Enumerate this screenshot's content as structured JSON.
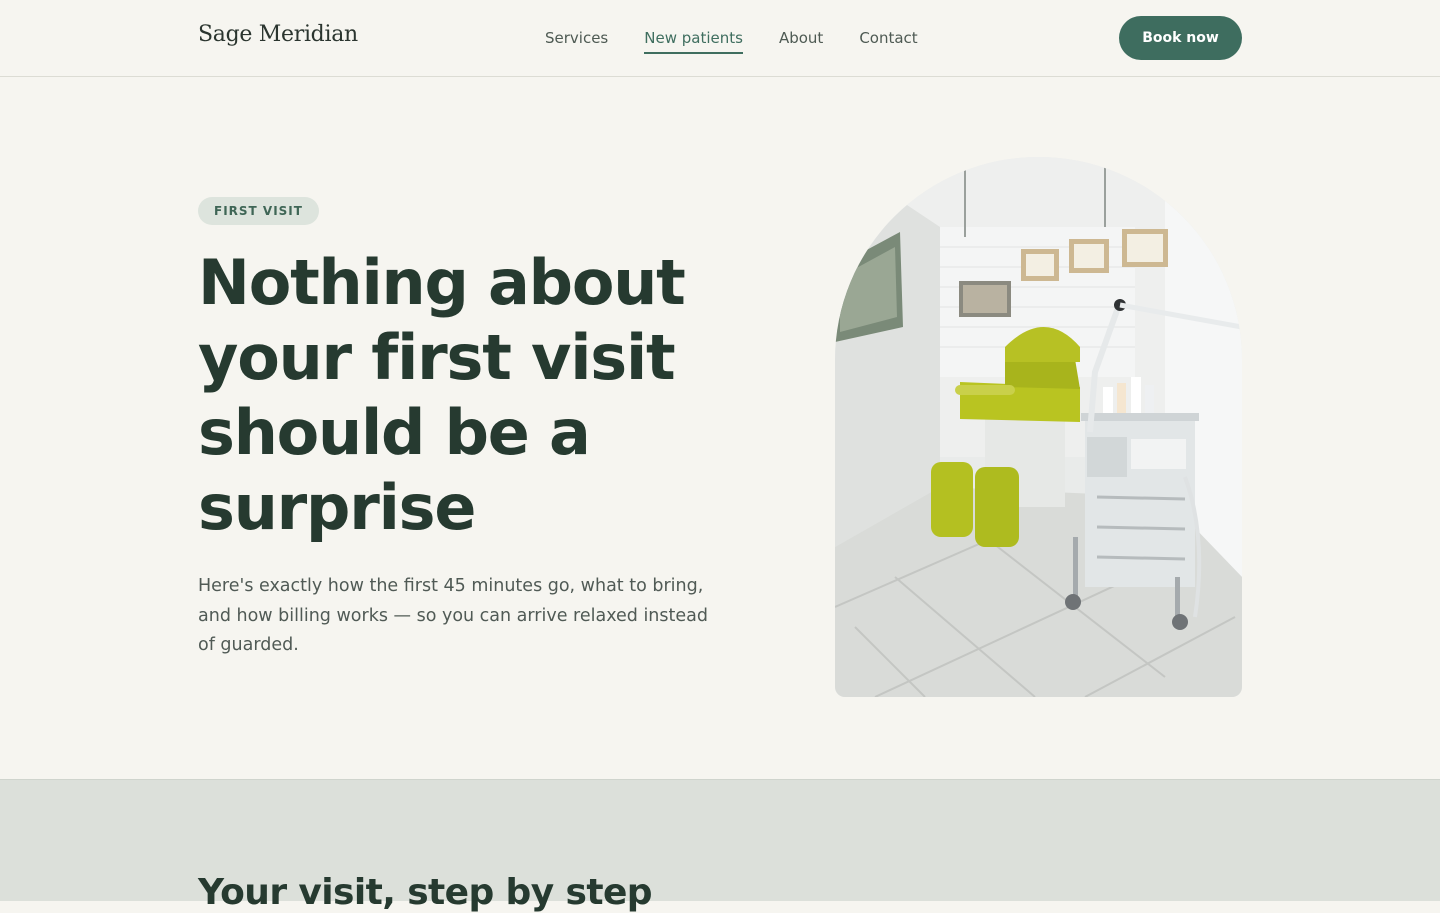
{
  "header": {
    "logo": "Sage Meridian",
    "nav": [
      "Services",
      "New patients",
      "About",
      "Contact"
    ],
    "active_nav": "New patients",
    "cta_label": "Book now"
  },
  "hero": {
    "badge": "FIRST VISIT",
    "title": "Nothing about your first visit should be a surprise",
    "subtitle": "Here's exactly how the first 45 minutes go, what to bring, and how billing works — so you can arrive relaxed instead of guarded.",
    "image_alt": "Treatment room with a lime green podiatry chair and equipment cart"
  },
  "steps": {
    "title": "Your visit, step by step"
  },
  "colors": {
    "accent": "#3e6d5f",
    "background": "#f6f5f0",
    "heading": "#263a30",
    "section_bg": "#dce0da"
  }
}
